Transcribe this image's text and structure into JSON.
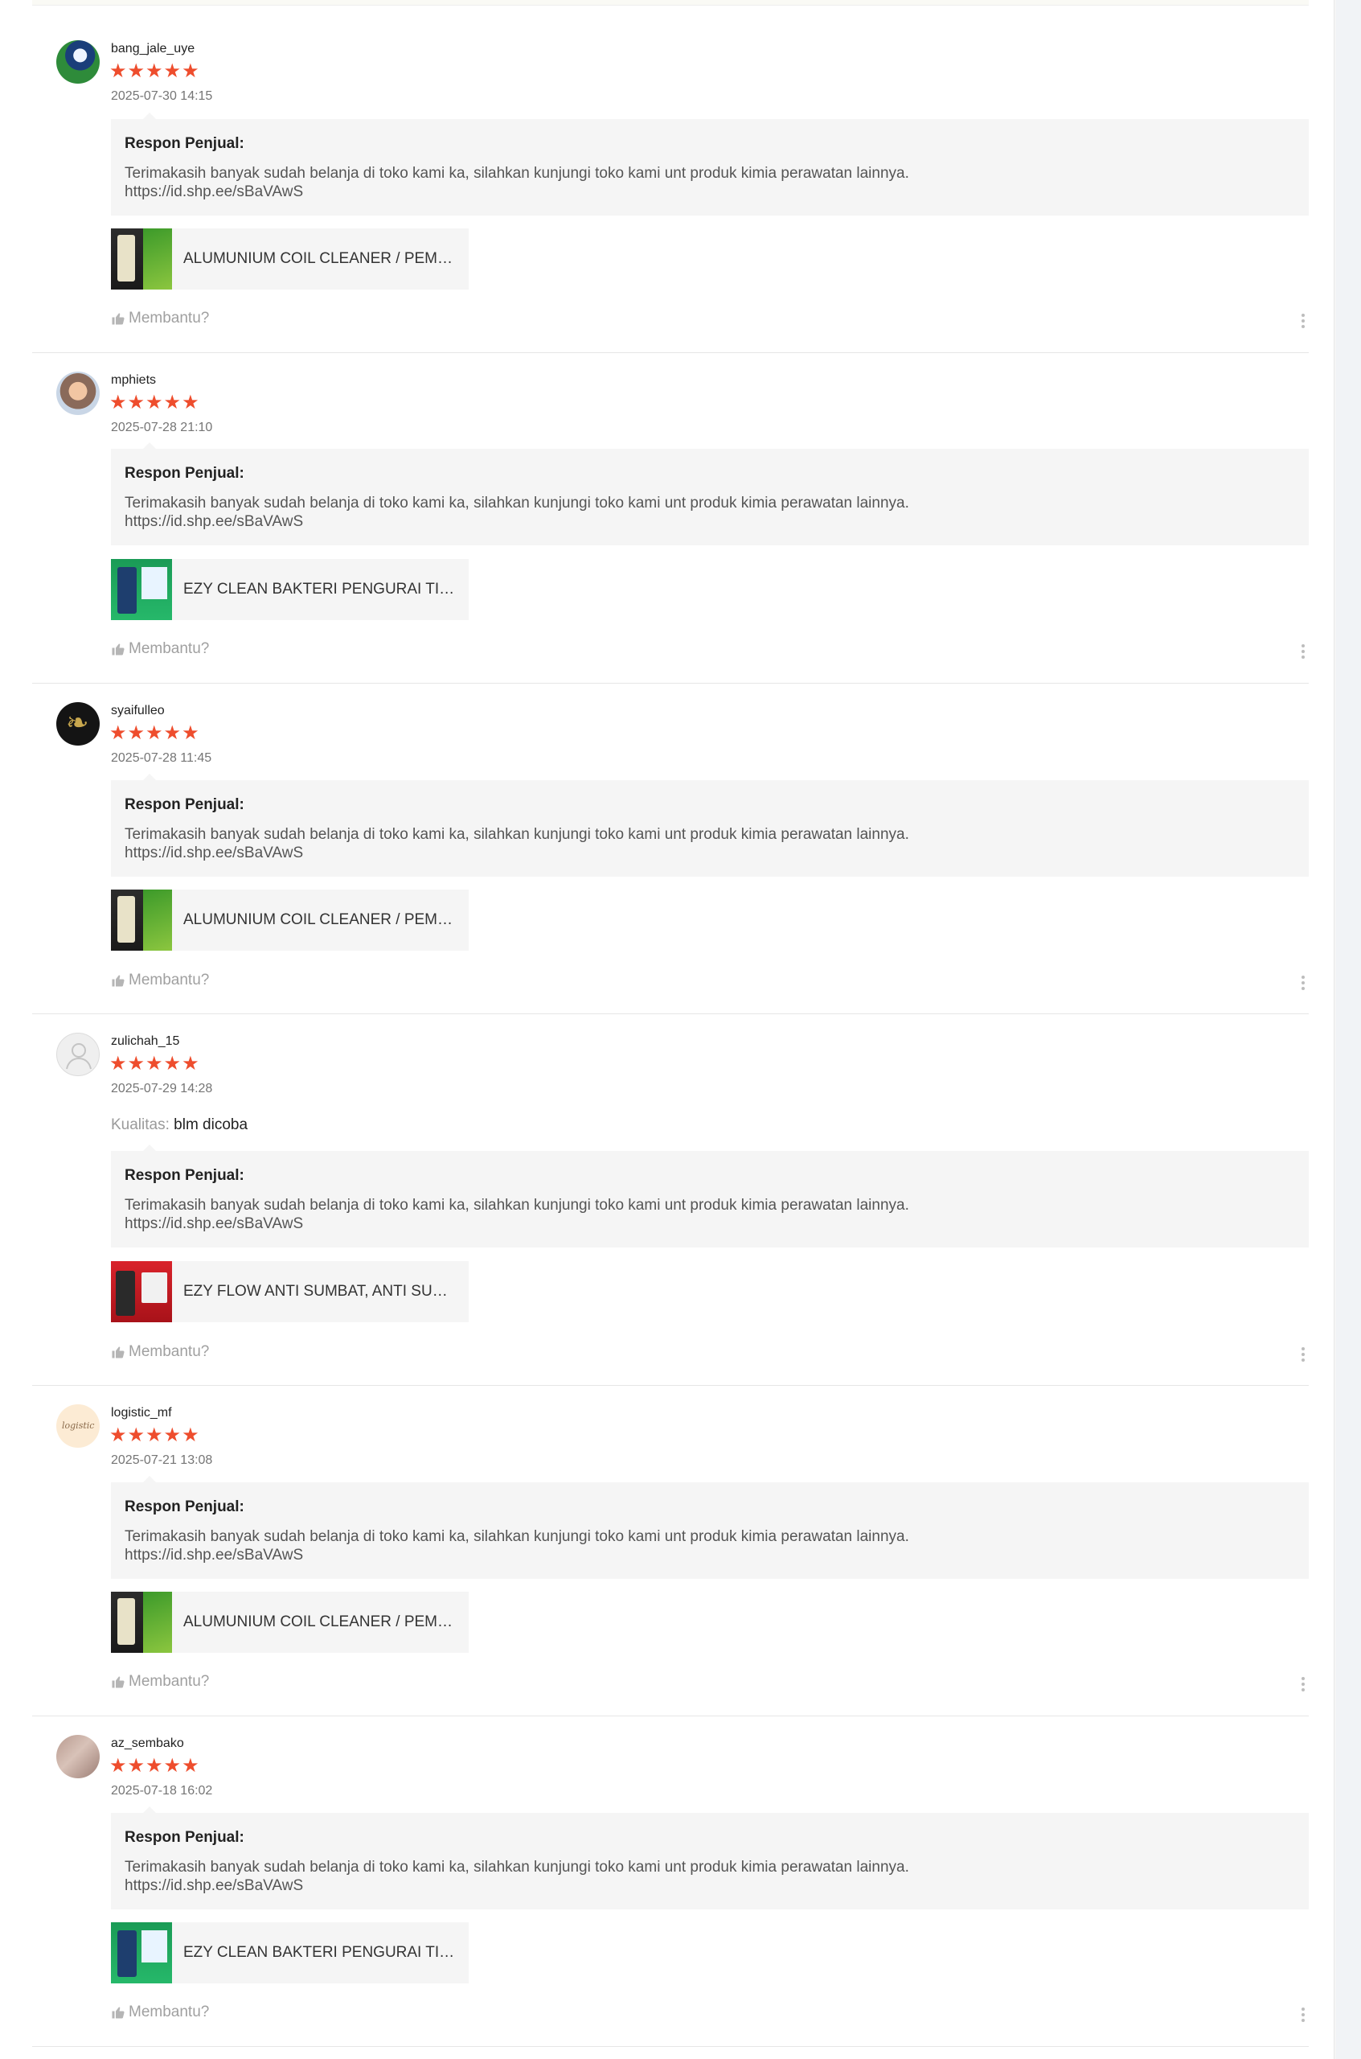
{
  "reviews": [
    {
      "username": "bang_jale_uye",
      "stars": "★★★★★",
      "date": "2025-07-30 14:15",
      "attribute": null,
      "seller_title": "Respon Penjual:",
      "seller_text": "Terimakasih banyak sudah belanja di toko kami ka, silahkan kunjungi toko kami unt produk kimia perawatan lainnya.\n https://id.shp.ee/sBaVAwS",
      "product_name": "ALUMUNIUM COIL CLEANER / PEMBERSIH",
      "helpful_label": "Membantu?",
      "avatar_icon": "user-photo-icon"
    },
    {
      "username": "mphiets",
      "stars": "★★★★★",
      "date": "2025-07-28 21:10",
      "attribute": null,
      "seller_title": "Respon Penjual:",
      "seller_text": "Terimakasih banyak sudah belanja di toko kami ka, silahkan kunjungi toko kami unt produk kimia perawatan lainnya.\n https://id.shp.ee/sBaVAwS",
      "product_name": "EZY CLEAN BAKTERI PENGURAI TINJA",
      "helpful_label": "Membantu?",
      "avatar_icon": "user-photo-icon"
    },
    {
      "username": "syaifulleo",
      "stars": "★★★★★",
      "date": "2025-07-28 11:45",
      "attribute": null,
      "seller_title": "Respon Penjual:",
      "seller_text": "Terimakasih banyak sudah belanja di toko kami ka, silahkan kunjungi toko kami unt produk kimia perawatan lainnya.\n https://id.shp.ee/sBaVAwS",
      "product_name": "ALUMUNIUM COIL CLEANER / PEMBERSIH",
      "helpful_label": "Membantu?",
      "avatar_icon": "user-photo-icon"
    },
    {
      "username": "zulichah_15",
      "stars": "★★★★★",
      "date": "2025-07-29 14:28",
      "attribute": {
        "label": "Kualitas:",
        "value": "blm dicoba"
      },
      "seller_title": "Respon Penjual:",
      "seller_text": "Terimakasih banyak sudah belanja di toko kami ka, silahkan kunjungi toko kami unt produk kimia perawatan lainnya.\n https://id.shp.ee/sBaVAwS",
      "product_name": "EZY FLOW ANTI SUMBAT, ANTI SUMBAT",
      "helpful_label": "Membantu?",
      "avatar_icon": "default-user-icon"
    },
    {
      "username": "logistic_mf",
      "stars": "★★★★★",
      "date": "2025-07-21 13:08",
      "attribute": null,
      "seller_title": "Respon Penjual:",
      "seller_text": "Terimakasih banyak sudah belanja di toko kami ka, silahkan kunjungi toko kami unt produk kimia perawatan lainnya.\n https://id.shp.ee/sBaVAwS",
      "product_name": "ALUMUNIUM COIL CLEANER / PEMBERSIH",
      "helpful_label": "Membantu?",
      "avatar_icon": "user-photo-icon"
    },
    {
      "username": "az_sembako",
      "stars": "★★★★★",
      "date": "2025-07-18 16:02",
      "attribute": null,
      "seller_title": "Respon Penjual:",
      "seller_text": "Terimakasih banyak sudah belanja di toko kami ka, silahkan kunjungi toko kami unt produk kimia perawatan lainnya.\n https://id.shp.ee/sBaVAwS",
      "product_name": "EZY CLEAN BAKTERI PENGURAI TINJA",
      "helpful_label": "Membantu?",
      "avatar_icon": "user-photo-icon"
    }
  ],
  "colors": {
    "star": "#ee4d2d",
    "seller_box_bg": "#f5f5f5",
    "muted_text": "#757575"
  },
  "icons": [
    "star-icon",
    "thumbs-up-icon",
    "more-vertical-icon",
    "default-user-icon"
  ]
}
